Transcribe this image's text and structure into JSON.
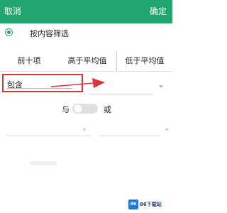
{
  "header": {
    "cancel_label": "取消",
    "confirm_label": "确定",
    "background_color": "#23a66d"
  },
  "filter_mode": {
    "label": "按内容筛选",
    "selected": true
  },
  "tabs": [
    {
      "label": "前十项"
    },
    {
      "label": "高于平均值"
    },
    {
      "label": "低于平均值"
    }
  ],
  "condition": {
    "operator_value": "包含",
    "value_text": "",
    "highlight_color": "#d9363e"
  },
  "logic": {
    "and_label": "与",
    "or_label": "或",
    "toggle_on": false
  },
  "watermark": {
    "text": "86下载站"
  }
}
